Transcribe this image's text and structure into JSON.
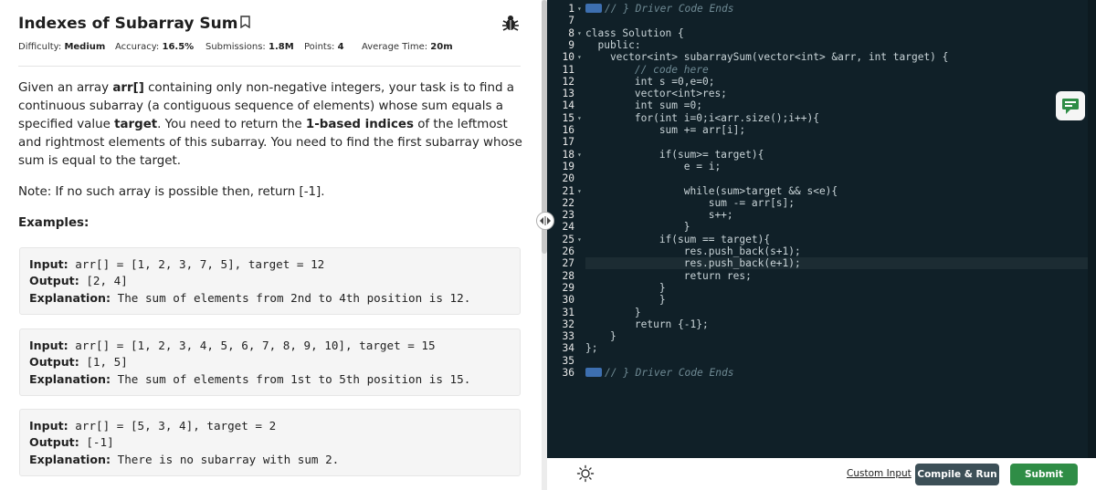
{
  "problem": {
    "title": "Indexes of Subarray Sum",
    "meta": {
      "difficulty_label": "Difficulty:",
      "difficulty_value": "Medium",
      "accuracy_label": "Accuracy:",
      "accuracy_value": "16.5%",
      "submissions_label": "Submissions:",
      "submissions_value": "1.8M",
      "points_label": "Points:",
      "points_value": "4",
      "time_label": "Average Time:",
      "time_value": "20m"
    },
    "description": {
      "p1": "Given an array ",
      "arr": "arr[]",
      "p2": " containing only non-negative integers, your task is to find a continuous subarray (a contiguous sequence of elements) whose sum equals a specified value ",
      "target": "target",
      "p3": ". You need to return the ",
      "indices": "1-based indices",
      "p4": " of the leftmost and rightmost elements of this subarray. You need to find the first subarray whose sum is equal to the target."
    },
    "note": "Note: If no such array is possible then, return [-1].",
    "examples_heading": "Examples:",
    "input_label": "Input:",
    "output_label": "Output:",
    "explanation_label": "Explanation:",
    "examples": [
      {
        "input": "arr[] = [1, 2, 3, 7, 5], target = 12",
        "output": "[2, 4]",
        "explanation": "The sum of elements from 2nd to 4th position is 12."
      },
      {
        "input": "arr[] = [1, 2, 3, 4, 5, 6, 7, 8, 9, 10], target = 15",
        "output": "[1, 5]",
        "explanation": "The sum of elements from 1st to 5th position is 15."
      },
      {
        "input": "arr[] = [5, 3, 4], target = 2",
        "output": "[-1]",
        "explanation": "There is no subarray with sum 2."
      }
    ]
  },
  "editor": {
    "line_numbers": [
      "1",
      "7",
      "8",
      "9",
      "10",
      "11",
      "12",
      "13",
      "14",
      "15",
      "16",
      "17",
      "18",
      "19",
      "20",
      "21",
      "22",
      "23",
      "24",
      "25",
      "26",
      "27",
      "28",
      "29",
      "30",
      "31",
      "32",
      "33",
      "34",
      "35",
      "36"
    ],
    "lines": [
      "// } Driver Code Ends",
      "",
      "class Solution {",
      "  public:",
      "    vector<int> subarraySum(vector<int> &arr, int target) {",
      "        // code here",
      "        int s =0,e=0;",
      "        vector<int>res;",
      "        int sum =0;",
      "        for(int i=0;i<arr.size();i++){",
      "            sum += arr[i];",
      "",
      "            if(sum>= target){",
      "                e = i;",
      "",
      "                while(sum>target && s<e){",
      "                    sum -= arr[s];",
      "                    s++;",
      "                }",
      "            if(sum == target){",
      "                res.push_back(s+1);",
      "                res.push_back(e+1);",
      "                return res;",
      "            }",
      "            }",
      "        }",
      "        return {-1};",
      "    }",
      "};",
      "",
      "// } Driver Code Ends"
    ]
  },
  "bottom_bar": {
    "custom_input": "Custom Input",
    "compile_run": "Compile & Run",
    "submit": "Submit"
  },
  "colors": {
    "editor_bg": "#102028",
    "compile_bg": "#3c4f57",
    "submit_bg": "#2f8d46"
  }
}
